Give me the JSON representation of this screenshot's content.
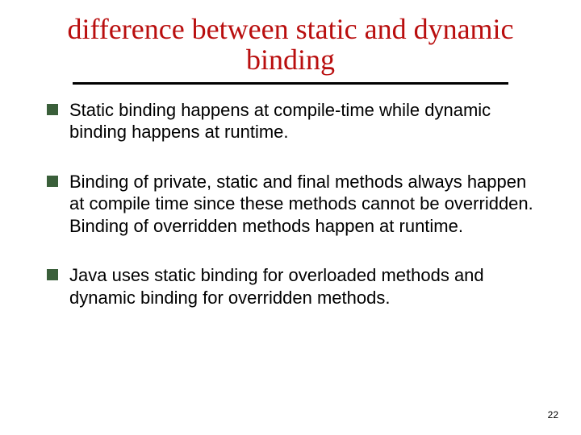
{
  "title": "difference between static and dynamic binding",
  "bullets": [
    "Static binding happens at compile-time while dynamic binding happens at runtime.",
    "Binding of private, static and final methods always happen at compile time since these methods cannot be overridden. Binding of overridden methods happen at runtime.",
    "Java uses static binding for overloaded methods and dynamic binding for overridden methods."
  ],
  "page_number": "22"
}
